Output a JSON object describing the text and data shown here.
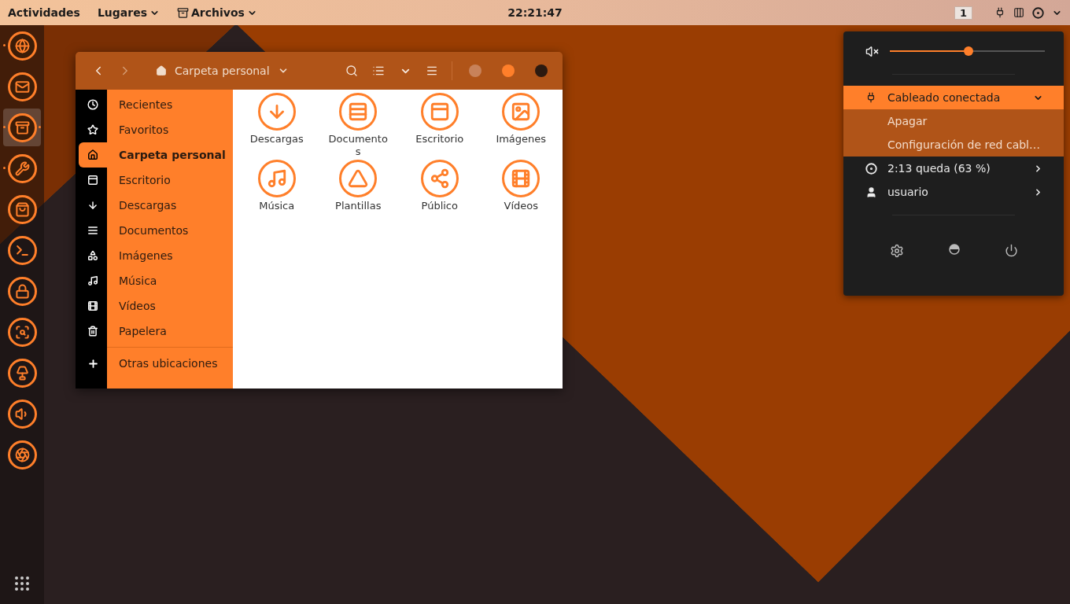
{
  "top_bar": {
    "activities": "Actividades",
    "menus": [
      {
        "label": "Lugares"
      },
      {
        "label": "Archivos"
      }
    ],
    "clock": "22:21:47",
    "workspace": "1"
  },
  "dock": {
    "apps": [
      {
        "running": true,
        "selected": false
      },
      {
        "running": false,
        "selected": false
      },
      {
        "running": true,
        "selected": true
      },
      {
        "running": true,
        "selected": false
      },
      {
        "running": false,
        "selected": false
      },
      {
        "running": false,
        "selected": false
      },
      {
        "running": false,
        "selected": false
      },
      {
        "running": false,
        "selected": false
      },
      {
        "running": false,
        "selected": false
      },
      {
        "running": false,
        "selected": false
      },
      {
        "running": false,
        "selected": false
      }
    ]
  },
  "file_window": {
    "location": "Carpeta personal",
    "places": [
      {
        "label": "Recientes",
        "selected": false
      },
      {
        "label": "Favoritos",
        "selected": false
      },
      {
        "label": "Carpeta personal",
        "selected": true
      },
      {
        "label": "Escritorio",
        "selected": false
      },
      {
        "label": "Descargas",
        "selected": false
      },
      {
        "label": "Documentos",
        "selected": false
      },
      {
        "label": "Imágenes",
        "selected": false
      },
      {
        "label": "Música",
        "selected": false
      },
      {
        "label": "Vídeos",
        "selected": false
      },
      {
        "label": "Papelera",
        "selected": false
      }
    ],
    "other_locations": "Otras ubicaciones",
    "folders": [
      {
        "label": "Descargas"
      },
      {
        "label": "Documentos"
      },
      {
        "label": "Escritorio"
      },
      {
        "label": "Imágenes"
      },
      {
        "label": "Música"
      },
      {
        "label": "Plantillas"
      },
      {
        "label": "Público"
      },
      {
        "label": "Vídeos"
      }
    ]
  },
  "system_menu": {
    "volume": {
      "level": 0.51
    },
    "network": {
      "label": "Cableado conectada",
      "selected": true,
      "expanded": true,
      "actions": [
        "Apagar",
        "Configuración de red cabl…"
      ]
    },
    "power": {
      "label": "2:13 queda (63 %)"
    },
    "user": {
      "label": "usuario"
    }
  }
}
